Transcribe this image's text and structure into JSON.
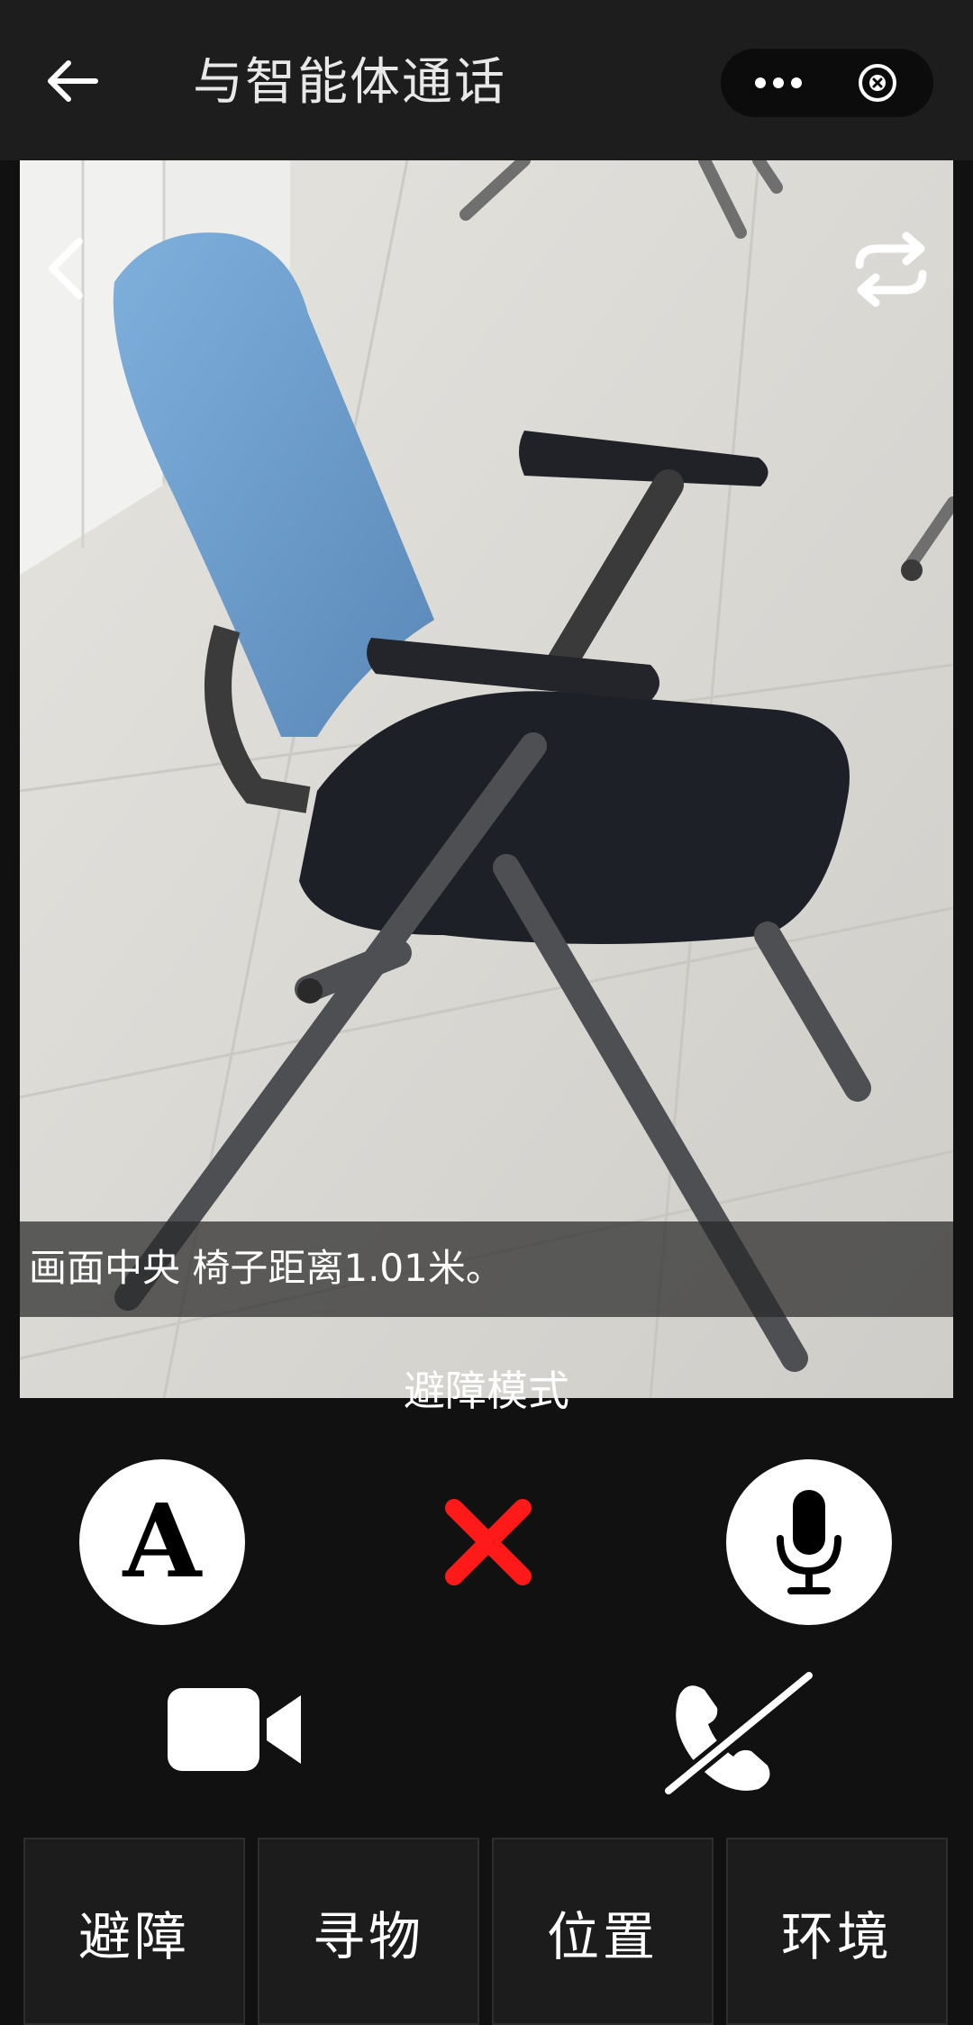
{
  "header": {
    "title": "与智能体通话",
    "back_icon": "arrow-left-icon",
    "more_icon": "more-dots-icon",
    "close_icon": "close-circle-icon"
  },
  "camera": {
    "back_icon": "chevron-left-icon",
    "switch_icon": "camera-switch-icon",
    "caption": "画面中央 椅子距离1.01米。"
  },
  "mode_label": "避障模式",
  "controls": {
    "font_label": "A",
    "font_icon": "font-size-icon",
    "cancel_icon": "cancel-x-icon",
    "mic_icon": "microphone-icon",
    "video_icon": "video-camera-icon",
    "hangup_icon": "hang-up-icon",
    "cancel_color": "#ff1a1a"
  },
  "tabs": [
    {
      "label": "避障"
    },
    {
      "label": "寻物"
    },
    {
      "label": "位置"
    },
    {
      "label": "环境"
    }
  ]
}
